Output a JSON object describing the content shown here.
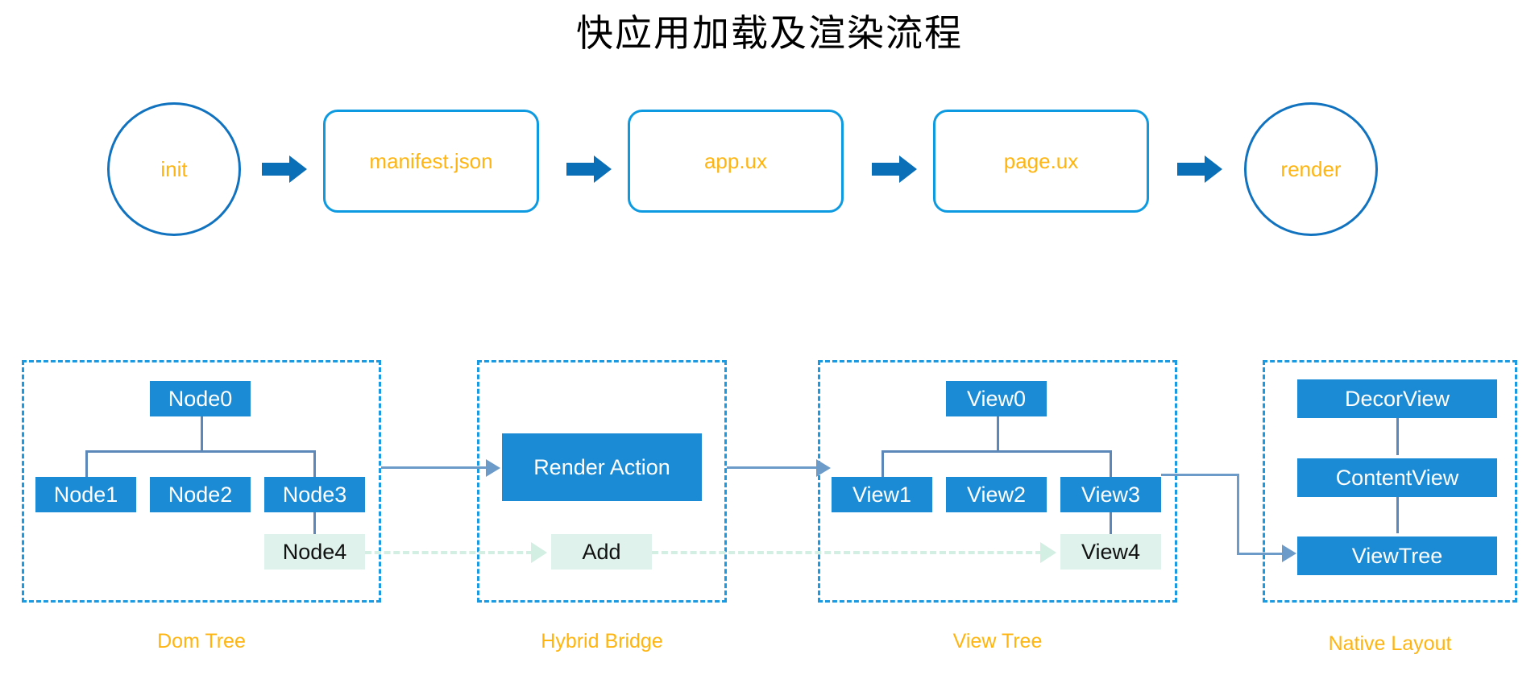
{
  "title": "快应用加载及渲染流程",
  "colors": {
    "accent_blue": "#1a8bd4",
    "flow_border_blue": "#0e9ae0",
    "circle_border_blue": "#1173bf",
    "arrow_blue": "#0b6fb8",
    "label_orange": "#FFB511",
    "connector_blue": "#6d9bc9",
    "tree_line_blue": "#5b87b9",
    "dashed_panel_blue": "#1b9ae2",
    "mint_box": "#dff3ec",
    "mint_dashed": "#d3eee3",
    "box_text": "#ffffff",
    "mint_box_text": "#111111"
  },
  "flow": {
    "steps": [
      {
        "label": "init",
        "shape": "circle"
      },
      {
        "label": "manifest.json",
        "shape": "rounded-rect"
      },
      {
        "label": "app.ux",
        "shape": "rounded-rect"
      },
      {
        "label": "page.ux",
        "shape": "rounded-rect"
      },
      {
        "label": "render",
        "shape": "circle"
      }
    ],
    "arrow_icon": "arrow-right-icon"
  },
  "panels": [
    {
      "key": "dom_tree",
      "label": "Dom Tree",
      "nodes": [
        {
          "label": "Node0",
          "style": "blue"
        },
        {
          "label": "Node1",
          "style": "blue"
        },
        {
          "label": "Node2",
          "style": "blue"
        },
        {
          "label": "Node3",
          "style": "blue"
        },
        {
          "label": "Node4",
          "style": "mint"
        }
      ]
    },
    {
      "key": "hybrid_bridge",
      "label": "Hybrid Bridge",
      "nodes": [
        {
          "label": "Render Action",
          "style": "blue"
        },
        {
          "label": "Add",
          "style": "mint"
        }
      ]
    },
    {
      "key": "view_tree",
      "label": "View Tree",
      "nodes": [
        {
          "label": "View0",
          "style": "blue"
        },
        {
          "label": "View1",
          "style": "blue"
        },
        {
          "label": "View2",
          "style": "blue"
        },
        {
          "label": "View3",
          "style": "blue"
        },
        {
          "label": "View4",
          "style": "mint"
        }
      ]
    },
    {
      "key": "native_layout",
      "label": "Native Layout",
      "nodes": [
        {
          "label": "DecorView",
          "style": "blue"
        },
        {
          "label": "ContentView",
          "style": "blue"
        },
        {
          "label": "ViewTree",
          "style": "blue"
        }
      ]
    }
  ]
}
